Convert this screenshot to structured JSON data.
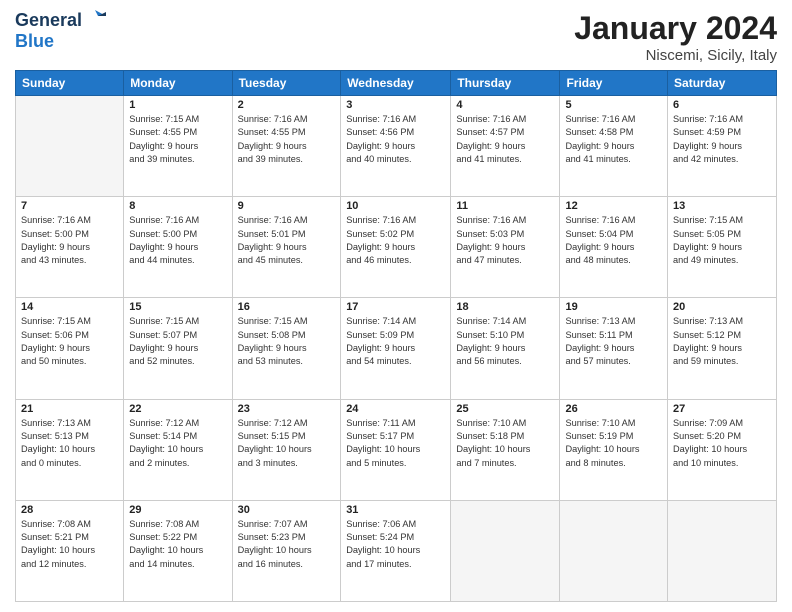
{
  "logo": {
    "line1": "General",
    "line2": "Blue"
  },
  "title": "January 2024",
  "subtitle": "Niscemi, Sicily, Italy",
  "days_header": [
    "Sunday",
    "Monday",
    "Tuesday",
    "Wednesday",
    "Thursday",
    "Friday",
    "Saturday"
  ],
  "weeks": [
    [
      {
        "num": "",
        "info": ""
      },
      {
        "num": "1",
        "info": "Sunrise: 7:15 AM\nSunset: 4:55 PM\nDaylight: 9 hours\nand 39 minutes."
      },
      {
        "num": "2",
        "info": "Sunrise: 7:16 AM\nSunset: 4:55 PM\nDaylight: 9 hours\nand 39 minutes."
      },
      {
        "num": "3",
        "info": "Sunrise: 7:16 AM\nSunset: 4:56 PM\nDaylight: 9 hours\nand 40 minutes."
      },
      {
        "num": "4",
        "info": "Sunrise: 7:16 AM\nSunset: 4:57 PM\nDaylight: 9 hours\nand 41 minutes."
      },
      {
        "num": "5",
        "info": "Sunrise: 7:16 AM\nSunset: 4:58 PM\nDaylight: 9 hours\nand 41 minutes."
      },
      {
        "num": "6",
        "info": "Sunrise: 7:16 AM\nSunset: 4:59 PM\nDaylight: 9 hours\nand 42 minutes."
      }
    ],
    [
      {
        "num": "7",
        "info": "Sunrise: 7:16 AM\nSunset: 5:00 PM\nDaylight: 9 hours\nand 43 minutes."
      },
      {
        "num": "8",
        "info": "Sunrise: 7:16 AM\nSunset: 5:00 PM\nDaylight: 9 hours\nand 44 minutes."
      },
      {
        "num": "9",
        "info": "Sunrise: 7:16 AM\nSunset: 5:01 PM\nDaylight: 9 hours\nand 45 minutes."
      },
      {
        "num": "10",
        "info": "Sunrise: 7:16 AM\nSunset: 5:02 PM\nDaylight: 9 hours\nand 46 minutes."
      },
      {
        "num": "11",
        "info": "Sunrise: 7:16 AM\nSunset: 5:03 PM\nDaylight: 9 hours\nand 47 minutes."
      },
      {
        "num": "12",
        "info": "Sunrise: 7:16 AM\nSunset: 5:04 PM\nDaylight: 9 hours\nand 48 minutes."
      },
      {
        "num": "13",
        "info": "Sunrise: 7:15 AM\nSunset: 5:05 PM\nDaylight: 9 hours\nand 49 minutes."
      }
    ],
    [
      {
        "num": "14",
        "info": "Sunrise: 7:15 AM\nSunset: 5:06 PM\nDaylight: 9 hours\nand 50 minutes."
      },
      {
        "num": "15",
        "info": "Sunrise: 7:15 AM\nSunset: 5:07 PM\nDaylight: 9 hours\nand 52 minutes."
      },
      {
        "num": "16",
        "info": "Sunrise: 7:15 AM\nSunset: 5:08 PM\nDaylight: 9 hours\nand 53 minutes."
      },
      {
        "num": "17",
        "info": "Sunrise: 7:14 AM\nSunset: 5:09 PM\nDaylight: 9 hours\nand 54 minutes."
      },
      {
        "num": "18",
        "info": "Sunrise: 7:14 AM\nSunset: 5:10 PM\nDaylight: 9 hours\nand 56 minutes."
      },
      {
        "num": "19",
        "info": "Sunrise: 7:13 AM\nSunset: 5:11 PM\nDaylight: 9 hours\nand 57 minutes."
      },
      {
        "num": "20",
        "info": "Sunrise: 7:13 AM\nSunset: 5:12 PM\nDaylight: 9 hours\nand 59 minutes."
      }
    ],
    [
      {
        "num": "21",
        "info": "Sunrise: 7:13 AM\nSunset: 5:13 PM\nDaylight: 10 hours\nand 0 minutes."
      },
      {
        "num": "22",
        "info": "Sunrise: 7:12 AM\nSunset: 5:14 PM\nDaylight: 10 hours\nand 2 minutes."
      },
      {
        "num": "23",
        "info": "Sunrise: 7:12 AM\nSunset: 5:15 PM\nDaylight: 10 hours\nand 3 minutes."
      },
      {
        "num": "24",
        "info": "Sunrise: 7:11 AM\nSunset: 5:17 PM\nDaylight: 10 hours\nand 5 minutes."
      },
      {
        "num": "25",
        "info": "Sunrise: 7:10 AM\nSunset: 5:18 PM\nDaylight: 10 hours\nand 7 minutes."
      },
      {
        "num": "26",
        "info": "Sunrise: 7:10 AM\nSunset: 5:19 PM\nDaylight: 10 hours\nand 8 minutes."
      },
      {
        "num": "27",
        "info": "Sunrise: 7:09 AM\nSunset: 5:20 PM\nDaylight: 10 hours\nand 10 minutes."
      }
    ],
    [
      {
        "num": "28",
        "info": "Sunrise: 7:08 AM\nSunset: 5:21 PM\nDaylight: 10 hours\nand 12 minutes."
      },
      {
        "num": "29",
        "info": "Sunrise: 7:08 AM\nSunset: 5:22 PM\nDaylight: 10 hours\nand 14 minutes."
      },
      {
        "num": "30",
        "info": "Sunrise: 7:07 AM\nSunset: 5:23 PM\nDaylight: 10 hours\nand 16 minutes."
      },
      {
        "num": "31",
        "info": "Sunrise: 7:06 AM\nSunset: 5:24 PM\nDaylight: 10 hours\nand 17 minutes."
      },
      {
        "num": "",
        "info": ""
      },
      {
        "num": "",
        "info": ""
      },
      {
        "num": "",
        "info": ""
      }
    ]
  ]
}
